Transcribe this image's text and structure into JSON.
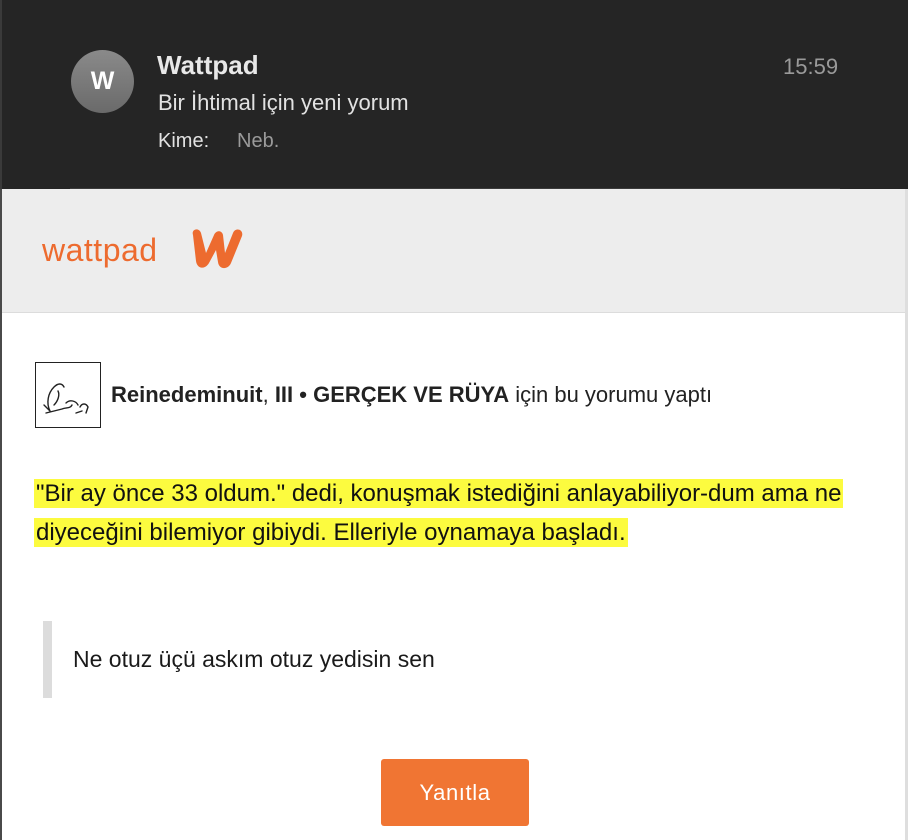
{
  "mail": {
    "avatar_letter": "W",
    "sender": "Wattpad",
    "time": "15:59",
    "subject": "Bir İhtimal için yeni yorum",
    "to_label": "Kime:",
    "to_value": "Neb."
  },
  "brand": {
    "name": "wattpad",
    "accent_color": "#ed6b2f",
    "logo_icon": "wattpad-w-logo"
  },
  "comment": {
    "username": "Reinedeminuit",
    "separator": ", ",
    "chapter": "III • GERÇEK VE RÜYA",
    "suffix": " için bu yorumu yaptı",
    "quote": "\"Bir ay önce 33 oldum.\" dedi, konuşmak istediğini anlayabiliyor-dum ama ne diyeceğini bilemiyor gibiydi. Elleriyle oynamaya başladı.",
    "highlight_color": "#fcfb3f",
    "reply_text": "Ne otuz üçü askım otuz yedisin sen"
  },
  "actions": {
    "reply_button": "Yanıtla",
    "button_color": "#f07533"
  }
}
